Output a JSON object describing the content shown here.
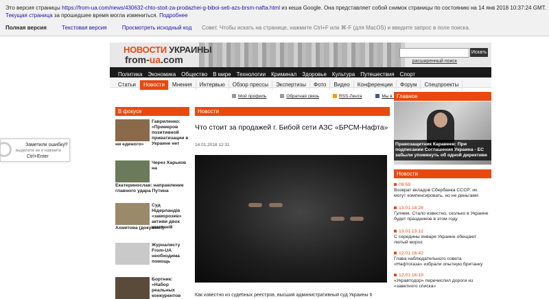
{
  "cache_bar": {
    "line1_prefix": "Это версия страницы ",
    "cached_url": "https://from-ua.com/news/430632-chto-stoit-za-prodazhei-g-biboi-seti-azs-brsm-nafta.html",
    "line1_suffix": " из кеша Google. Она представляет собой снимок страницы по состоянию на 14 янв 2018 10:37:24 GMT.",
    "current_page_link": "Текущая страница",
    "line2_text": " за прошедшее время могла измениться. ",
    "more_link": "Подробнее",
    "full_version": "Полная версия",
    "text_version": "Текстовая версия",
    "view_source": "Просмотреть исходный код",
    "tip": "Совет. Чтобы искать на странице, нажмите Ctrl+F или ⌘-F (для MacOS) и введите запрос в поле поиска."
  },
  "site": {
    "logo_top_news": "НОВОСТИ",
    "logo_top_region": "УКРАИНЫ",
    "logo_bottom_from": "from-",
    "logo_bottom_ua": "ua",
    "logo_bottom_com": ".com",
    "search_button": "Искать",
    "advanced_search": "расширенный поиск",
    "nav": [
      "Политика",
      "Экономика",
      "Общество",
      "В мире",
      "Технологии",
      "Криминал",
      "Здоровье",
      "Культура",
      "Путешествия",
      "Спорт"
    ],
    "subnav": [
      "Статьи",
      "Новости",
      "Мнения",
      "Интервью",
      "Обзор прессы",
      "Экспертизы",
      "Фото",
      "Видео",
      "Конференции",
      "Форум",
      "Спецпроекты"
    ],
    "subnav_active": "Новости",
    "util": [
      "Мой профиль",
      "Обратная связь",
      "RSS-Лента",
      "Мы в Facebook"
    ]
  },
  "focus": {
    "header": "В фокусе",
    "items": [
      {
        "title": "Гавриленко: «Примеров позитивной приватизации в Украине нет",
        "cont": "ни единого»"
      },
      {
        "title": "Через Харьков на",
        "cont": "Екатеринослав: направление главного удара Путина"
      },
      {
        "title": "Суд Нідерландів «заморозив» активи двох компаній",
        "cont": "Ахметова (документ)"
      },
      {
        "title": "Журналисту From-UA необходима помощь",
        "cont": ""
      },
      {
        "title": "Бортник: «Набор реальных конкурентов",
        "cont": ""
      }
    ]
  },
  "article": {
    "section": "Новости",
    "title": "Что стоит за продажей г. Бибой сети АЗС «БРСМ-Нафта»",
    "date": "14.01.2018 12:31",
    "lead": "Как известно из судебных реестров, высший административный суд Украины б"
  },
  "main_block": {
    "header": "Главное",
    "caption": "Правозащитник Каравеев: При подписании Соглашения Украина - ЕС забыли упомянуть об одной директиве"
  },
  "news_block": {
    "header": "Новости",
    "items": [
      {
        "time": "09:59",
        "text": "Возврат вкладов Сбербанка СССР: их могут компенсировать, но не деньгами"
      },
      {
        "time": "13.01 18:28",
        "text": "Гуляем. Стало известно, сколько в Украине будет праздников в этом году"
      },
      {
        "time": "13.01 13:12",
        "text": "С середины января Украине обещают лютый мороз"
      },
      {
        "time": "12.01 16:42",
        "text": "Глава наблюдательного совета «Нафтогаза» избрали опытную британку"
      },
      {
        "time": "12.01 16:19",
        "text": "«Укравтодор» перечислил дороги из «заветного списка»"
      }
    ]
  },
  "error_popup": {
    "title": "Заметили ошибку?",
    "hint": "выделите ее и нажмите",
    "keys": "Ctrl+Enter"
  }
}
